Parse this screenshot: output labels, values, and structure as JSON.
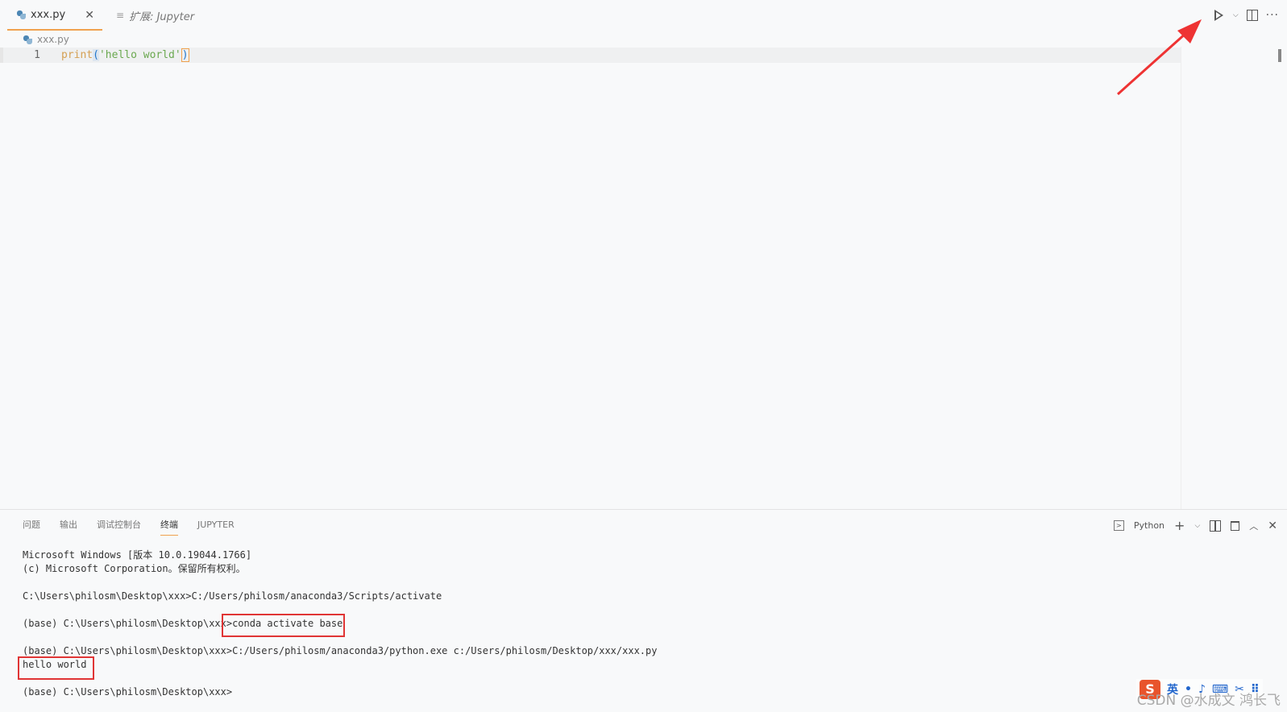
{
  "tabs": {
    "active": {
      "label": "xxx.py",
      "close": "✕"
    },
    "inactive": {
      "label": "扩展: Jupyter",
      "icon_glyph": "≡"
    }
  },
  "breadcrumb": {
    "file": "xxx.py"
  },
  "editor": {
    "line_number": "1",
    "code": {
      "fn": "print",
      "open": "(",
      "str": "'hello world'",
      "close": ")"
    }
  },
  "toolbar": {
    "more": "···",
    "chevron": "⌵"
  },
  "panel": {
    "tabs": [
      "问题",
      "输出",
      "调试控制台",
      "终端",
      "JUPYTER"
    ],
    "active_tab": "终端",
    "shell_label": "Python",
    "plus": "+",
    "chevron": "⌵",
    "caret_up": "︿",
    "close": "✕"
  },
  "terminal": {
    "lines": [
      "Microsoft Windows [版本 10.0.19044.1766]",
      "(c) Microsoft Corporation。保留所有权利。",
      "",
      "C:\\Users\\philosm\\Desktop\\xxx>C:/Users/philosm/anaconda3/Scripts/activate",
      "",
      "(base) C:\\Users\\philosm\\Desktop\\xxx>conda activate base",
      "",
      "(base) C:\\Users\\philosm\\Desktop\\xxx>C:/Users/philosm/anaconda3/python.exe c:/Users/philosm/Desktop/xxx/xxx.py",
      "hello world",
      "",
      "(base) C:\\Users\\philosm\\Desktop\\xxx>"
    ]
  },
  "ime": {
    "logo": "S",
    "lang": "英",
    "items": [
      "•",
      "♪",
      "⌨",
      "✂",
      "⠿"
    ]
  },
  "watermark": "CSDN @水成文 鸿长飞",
  "colors": {
    "accent": "#f0a24f",
    "annotation": "#e03535"
  }
}
